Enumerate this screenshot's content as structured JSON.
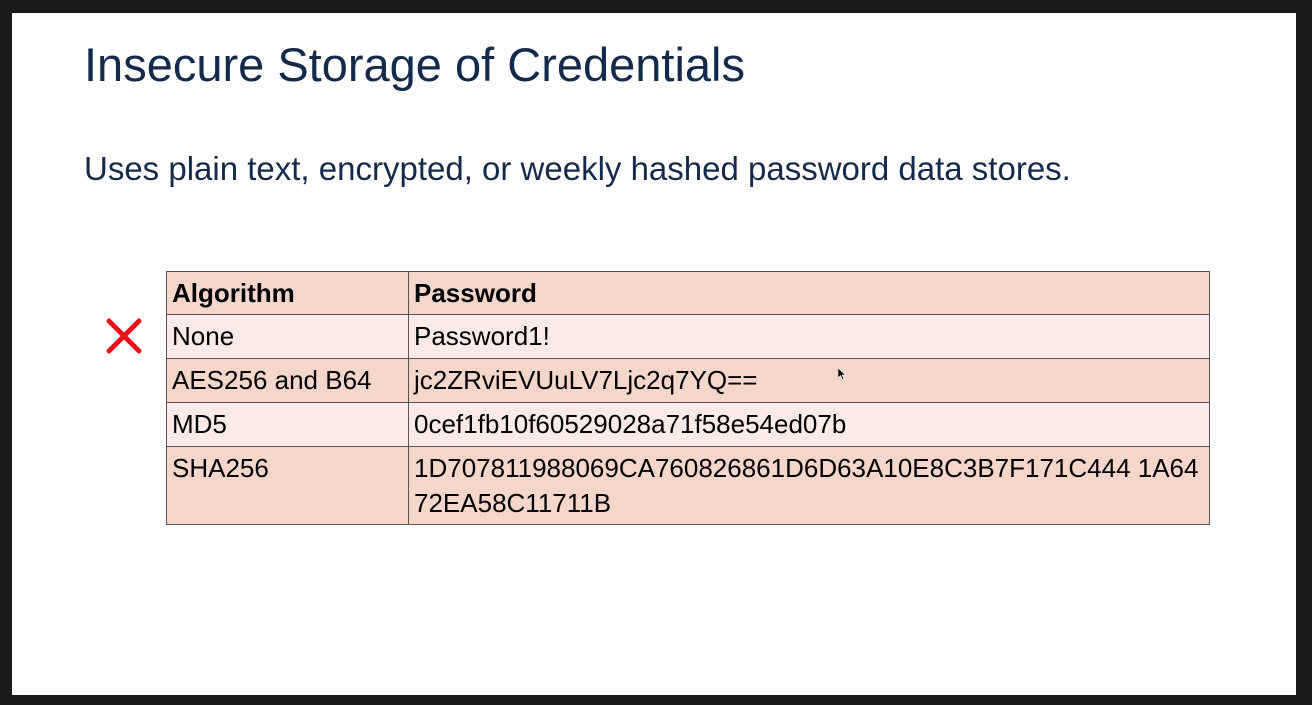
{
  "slide": {
    "title": "Insecure Storage of Credentials",
    "subtitle": "Uses plain text, encrypted, or weekly hashed password data stores."
  },
  "table": {
    "headers": [
      "Algorithm",
      "Password"
    ],
    "rows": [
      {
        "algorithm": "None",
        "password": "Password1!"
      },
      {
        "algorithm": "AES256 and B64",
        "password": "jc2ZRviEVUuLV7Ljc2q7YQ=="
      },
      {
        "algorithm": "MD5",
        "password": "0cef1fb10f60529028a71f58e54ed07b"
      },
      {
        "algorithm": "SHA256",
        "password": "1D707811988069CA760826861D6D63A10E8C3B7F171C444 1A6472EA58C11711B"
      }
    ]
  },
  "marker": {
    "icon": "x-mark-icon",
    "color": "#e8131b"
  },
  "colors": {
    "title": "#15294a",
    "header_fill": "#f4d6cb",
    "row_light": "#fbeae5",
    "row_dark": "#f4d6cb"
  }
}
